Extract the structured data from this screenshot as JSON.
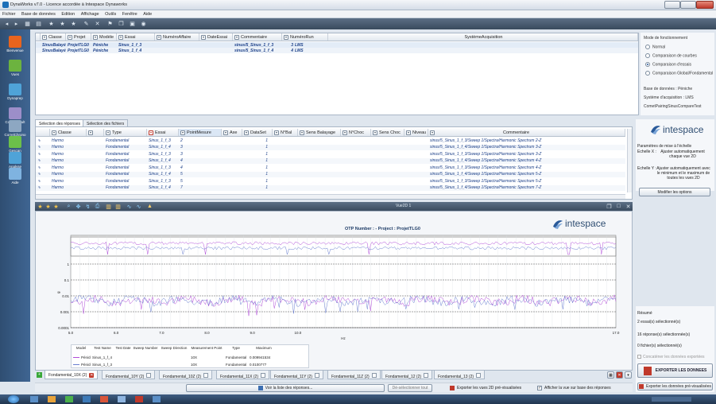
{
  "window": {
    "title": "DynaWorks v7.0 - Licence accordée à Intespace Dynaworks"
  },
  "menu": [
    "Fichier",
    "Base de données",
    "Edition",
    "Affichage",
    "Outils",
    "Fenêtre",
    "Aide"
  ],
  "nav": [
    {
      "label": "Bienvenue",
      "icon": "home-icon",
      "color": "#e8641e"
    },
    {
      "label": "Vues",
      "icon": "chart-icon",
      "color": "#6cb33f"
    },
    {
      "label": "Dynaprep",
      "icon": "people-icon",
      "color": "#4fa3d8"
    },
    {
      "label": "CorrelResult",
      "icon": "compare-icon",
      "color": "#9c8ec9"
    },
    {
      "label": "CorrelChrono",
      "icon": "wave-icon",
      "color": "#8da7c2"
    },
    {
      "label": "Gescan",
      "icon": "antenna-icon",
      "color": "#6cc04a"
    },
    {
      "label": "Analyse",
      "icon": "gear-icon",
      "color": "#4fa3d8"
    },
    {
      "label": "Aide",
      "icon": "help-icon",
      "color": "#7fb3e0"
    }
  ],
  "test_grid": {
    "columns": [
      "Classe",
      "Projet",
      "Modèle",
      "Essai",
      "NuméroAffaire",
      "DateEssai",
      "Commentaire",
      "NuméroRun",
      "SystèmeAcquisition"
    ],
    "rows": [
      [
        "SinusBalayé",
        "ProjetTLG0",
        "Péniche",
        "Sinus_1_f_3",
        "",
        "",
        "sinus/5_Sinus_1_f_3",
        "3",
        "LMS"
      ],
      [
        "SinusBalayé",
        "ProjetTLG0",
        "Péniche",
        "Sinus_1_f_4",
        "",
        "",
        "sinus/5_Sinus_1_f_4",
        "4",
        "LMS"
      ]
    ]
  },
  "options": {
    "mode_title": "Mode de fonctionnement",
    "modes": [
      {
        "label": "Normal",
        "selected": false
      },
      {
        "label": "Comparaison de courbes",
        "selected": false
      },
      {
        "label": "Comparaison d'essais",
        "selected": true
      },
      {
        "label": "Comparaison Global/Fondamental",
        "selected": false
      }
    ],
    "database": "Base de données : Péniche",
    "acq_system": "Système d'acquisition : LMS",
    "comet": "CometPairingSinusCompareTest"
  },
  "resp_tabs": [
    "Sélection des réponses",
    "Sélection des fichiers"
  ],
  "resp_grid": {
    "columns": [
      "Classe",
      "",
      "Type",
      "Essai",
      "PointMesure",
      "Axe",
      "DataSet",
      "N°Bal",
      "Sens Balayage",
      "N°Choc",
      "Sens Choc",
      "Niveau",
      "Commentaire"
    ],
    "rows": [
      [
        "Harmo",
        "Fondamental",
        "Sinus_1_f_3",
        "2",
        "1",
        "sinus/5_Sinus_1_f_3/Sweep 1/Spectra/Harmonic Spectrum 2-Z"
      ],
      [
        "Harmo",
        "Fondamental",
        "Sinus_1_f_4",
        "3",
        "1",
        "sinus/5_Sinus_1_f_4/Sweep 1/Spectra/Harmonic Spectrum 3-Z"
      ],
      [
        "Harmo",
        "Fondamental",
        "Sinus_1_f_3",
        "3",
        "1",
        "sinus/5_Sinus_1_f_3/Sweep 1/Spectra/Harmonic Spectrum 3-Z"
      ],
      [
        "Harmo",
        "Fondamental",
        "Sinus_1_f_4",
        "4",
        "1",
        "sinus/5_Sinus_1_f_4/Sweep 1/Spectra/Harmonic Spectrum 4-Z"
      ],
      [
        "Harmo",
        "Fondamental",
        "Sinus_1_f_3",
        "4",
        "1",
        "sinus/5_Sinus_1_f_3/Sweep 1/Spectra/Harmonic Spectrum 4-Z"
      ],
      [
        "Harmo",
        "Fondamental",
        "Sinus_1_f_4",
        "5",
        "1",
        "sinus/5_Sinus_1_f_4/Sweep 1/Spectra/Harmonic Spectrum 5-Z"
      ],
      [
        "Harmo",
        "Fondamental",
        "Sinus_1_f_3",
        "5",
        "1",
        "sinus/5_Sinus_1_f_3/Sweep 1/Spectra/Harmonic Spectrum 5-Z"
      ],
      [
        "Harmo",
        "Fondamental",
        "Sinus_1_f_4",
        "7",
        "1",
        "sinus/5_Sinus_1_f_4/Sweep 1/Spectra/Harmonic Spectrum 7-Z"
      ]
    ]
  },
  "brand": "intespace",
  "scaling": {
    "title": "Paramètres de mise à l'échelle",
    "x_label": "Echelle X :",
    "x_value": "Ajuster automatiquement chaque vue 2D",
    "y_label": "Echelle Y :",
    "y_value": "Ajuster automatiquement avec le minimum et le maximum de toutes les vues 2D",
    "modify_button": "Modifier les options"
  },
  "summary": {
    "title": "Résumé",
    "tests": "2 essai(s) sélectionné(s)",
    "responses": "16 réponse(s) sélectionnée(s)",
    "files": "0 fichier(s) sélectionné(s)",
    "concat": "Concaténer les données exportées",
    "export_button": "EXPORTER LES DONNEES",
    "export_pre": "Exporter les données pré-visualisées"
  },
  "view": {
    "tab": "Vue2D 1",
    "header": "OTP Number :  - Project : ProjetTLG0",
    "xlabel": "Hz"
  },
  "chart_data": {
    "type": "line",
    "xlabel": "Hz",
    "ylabel": "g",
    "xlim": [
      5.0,
      17.0
    ],
    "x_ticks": [
      "5.0",
      "6.0",
      "7.0",
      "8.0",
      "9.0",
      "10.0",
      "17.0"
    ],
    "y_ticks": [
      "0.0001",
      "0.001",
      "0.01",
      "0.1",
      "1"
    ],
    "y_scale": "log",
    "series": [
      {
        "name": "Sinus_1_f_4",
        "color": "#b04cd8"
      },
      {
        "name": "Sinus_1_f_3",
        "color": "#6a7fd0"
      }
    ]
  },
  "legend": {
    "columns": [
      "Model",
      "Test Name",
      "Test Date",
      "Sweep Number",
      "Sweep Direction",
      "Measurement Point",
      "Type",
      "Maximum"
    ],
    "rows": [
      [
        "Péniche",
        "Sinus_1_f_4",
        "",
        "",
        "",
        "10X",
        "Fondamental",
        "0.009941534"
      ],
      [
        "Péniche",
        "Sinus_1_f_3",
        "",
        "",
        "",
        "10X",
        "Fondamental",
        "0.0100777"
      ]
    ]
  },
  "plot_tabs": [
    "Fondamental_10X (2)",
    "Fondamental_10Y (2)",
    "Fondamental_10Z (2)",
    "Fondamental_11X (2)",
    "Fondamental_11Y (2)",
    "Fondamental_11Z (2)",
    "Fondamental_12 (2)",
    "Fondamental_13 (2)"
  ],
  "bottom": {
    "list_button": "Voir la liste des réponses...",
    "deselect": "Dé-sélectionner tout",
    "export_views": "Exporter les vues 2D pré-visualisées",
    "show_view": "Afficher la vue sur base des réponses"
  }
}
